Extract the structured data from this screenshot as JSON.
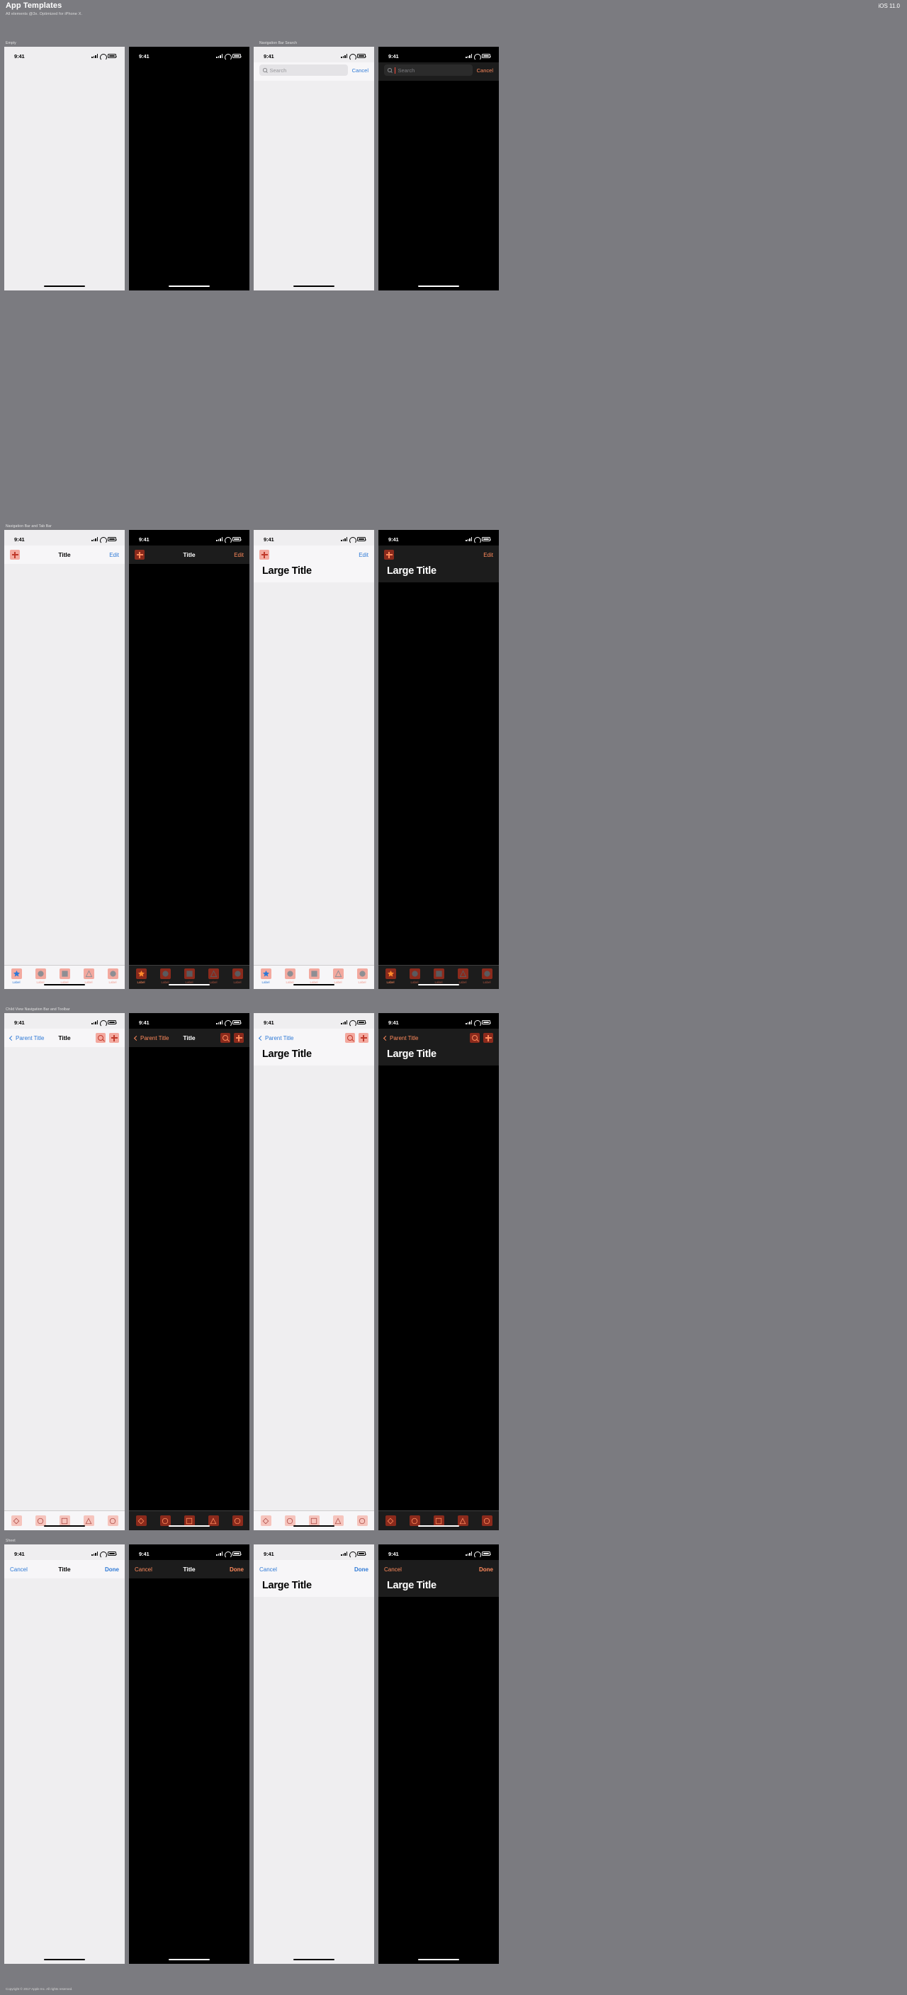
{
  "header": {
    "title": "App Templates",
    "subtitle": "All elements @3x. Optimized for iPhone X.",
    "os": "iOS 11.0"
  },
  "footer": {
    "copyright": "Copyright © 2017 Apple Inc. All rights reserved."
  },
  "status_bar": {
    "time": "9:41",
    "signal_icon": "cellular-bars-icon",
    "wifi_icon": "wifi-icon",
    "battery_icon": "battery-icon"
  },
  "colors": {
    "canvas": "#7b7b80",
    "light_bg": "#efeef0",
    "light_bar": "#f7f6f8",
    "dark_bg": "#000000",
    "dark_bar": "#1c1c1c",
    "tint_light": "#2f7ad6",
    "tint_dark": "#ff8a5c",
    "placeholder_light": "#f3a99f",
    "placeholder_dark": "#8b2a1c",
    "caret": "#ff4d3d"
  },
  "sections": [
    {
      "id": "empty",
      "label": "Empty"
    },
    {
      "id": "nav-search",
      "label": "Navigation Bar Search"
    },
    {
      "id": "nav-tab",
      "label": "Navigation Bar and Tab Bar"
    },
    {
      "id": "child-toolbar",
      "label": "Child View Navigation Bar and Toolbar"
    },
    {
      "id": "sheet",
      "label": "Sheet"
    }
  ],
  "search": {
    "placeholder": "Search",
    "value": "",
    "cancel_label": "Cancel",
    "search_icon": "search-icon"
  },
  "navbar": {
    "title": "Title",
    "large_title": "Large Title",
    "edit_label": "Edit",
    "parent_title": "Parent Title",
    "back_icon": "chevron-left-icon",
    "add_icon": "plus-icon",
    "search_icon": "search-icon"
  },
  "sheet": {
    "title": "Title",
    "large_title": "Large Title",
    "cancel_label": "Cancel",
    "done_label": "Done"
  },
  "tabbar": {
    "items": [
      {
        "label": "Label",
        "icon": "star-icon",
        "selected": true
      },
      {
        "label": "Label",
        "icon": "circle-icon",
        "selected": false
      },
      {
        "label": "Label",
        "icon": "square-icon",
        "selected": false
      },
      {
        "label": "Label",
        "icon": "triangle-icon",
        "selected": false
      },
      {
        "label": "Label",
        "icon": "circle-icon",
        "selected": false
      }
    ]
  },
  "toolbar": {
    "items": [
      {
        "icon": "diamond-outline-icon"
      },
      {
        "icon": "circle-outline-icon"
      },
      {
        "icon": "square-outline-icon"
      },
      {
        "icon": "triangle-outline-icon"
      },
      {
        "icon": "circle-outline-icon"
      }
    ]
  }
}
